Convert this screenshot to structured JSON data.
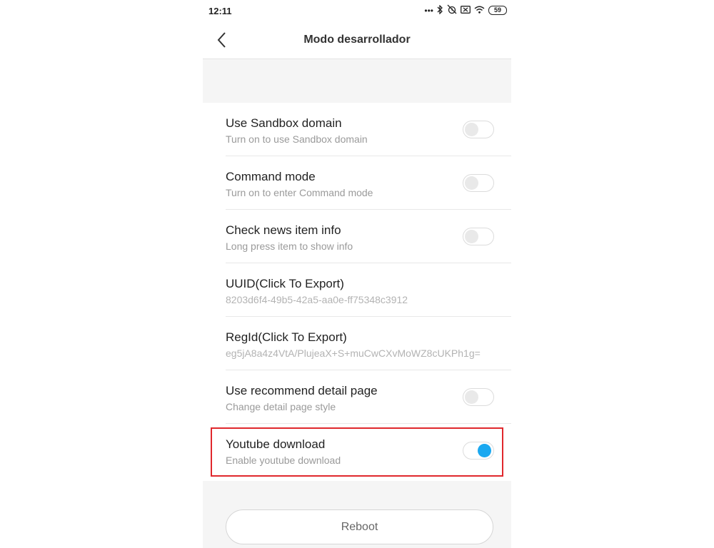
{
  "status_bar": {
    "time": "12:11",
    "battery": "59",
    "icons": [
      "dots-icon",
      "bluetooth-icon",
      "alarm-off-icon",
      "sim-icon",
      "wifi-icon",
      "battery-icon"
    ]
  },
  "header": {
    "title": "Modo desarrollador",
    "back_icon": "chevron-left-icon"
  },
  "settings": [
    {
      "title": "Use Sandbox domain",
      "subtitle": "Turn on to use Sandbox domain",
      "toggle": "off"
    },
    {
      "title": "Command mode",
      "subtitle": "Turn on to enter Command mode",
      "toggle": "off"
    },
    {
      "title": "Check news item info",
      "subtitle": "Long press item to show info",
      "toggle": "off"
    },
    {
      "title": "UUID(Click To Export)",
      "subtitle": "8203d6f4-49b5-42a5-aa0e-ff75348c3912"
    },
    {
      "title": "RegId(Click To Export)",
      "subtitle": "eg5jA8a4z4VtA/PlujeaX+S+muCwCXvMoWZ8cUKPh1g="
    },
    {
      "title": "Use recommend detail page",
      "subtitle": "Change detail page style",
      "toggle": "off"
    },
    {
      "title": "Youtube download",
      "subtitle": "Enable youtube download",
      "toggle": "on"
    }
  ],
  "reboot_button": "Reboot",
  "colors": {
    "accent": "#1aa8f0",
    "highlight": "#e0282d",
    "gray_band": "#f5f5f5"
  }
}
